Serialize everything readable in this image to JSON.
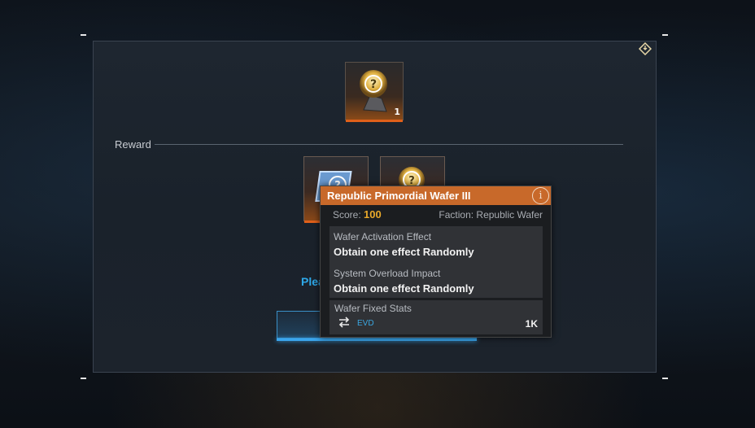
{
  "panel": {
    "reward_label": "Reward",
    "partial_prompt": "Plea",
    "top_item": {
      "quantity": "1",
      "icon": "mystery-wafer-icon"
    },
    "reward_items": [
      {
        "icon": "mystery-wafer-icon"
      },
      {
        "icon": "mystery-wafer-icon"
      }
    ],
    "confirm_button_label": ""
  },
  "tooltip": {
    "title": "Republic Primordial Wafer III",
    "info_glyph": "i",
    "score_label": "Score:",
    "score_value": "100",
    "faction": "Faction:  Republic Wafer",
    "activation_effect_title": "Wafer Activation Effect",
    "activation_effect_value": "Obtain one effect Randomly",
    "overload_title": "System Overload Impact",
    "overload_value": "Obtain one effect Randomly",
    "fixed_stats_title": "Wafer Fixed Stats",
    "stats": [
      {
        "name": "EVD",
        "value": "1K",
        "icon": "swap-arrows-icon"
      }
    ]
  },
  "colors": {
    "accent_orange": "#c8692a",
    "score_gold": "#e8a82a",
    "accent_blue": "#3aa6ee"
  }
}
